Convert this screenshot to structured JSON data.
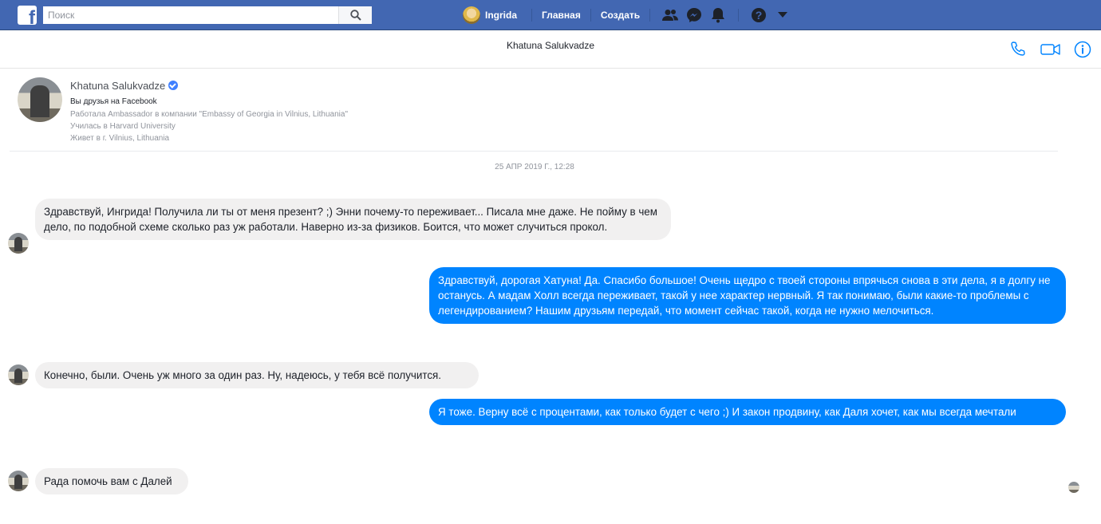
{
  "topbar": {
    "logo_letter": "f",
    "search": {
      "placeholder": "Поиск",
      "value": ""
    },
    "user_name": "Ingrida",
    "home_label": "Главная",
    "create_label": "Создать",
    "brand_color": "#4267b2"
  },
  "conversation": {
    "title": "Khatuna Salukvadze",
    "header_icons": [
      "phone-icon",
      "video-icon",
      "info-icon"
    ]
  },
  "profile": {
    "name": "Khatuna Salukvadze",
    "friends_text": "Вы друзья на Facebook",
    "work": "Работала Ambassador в компании \"Embassy of Georgia in Vilnius, Lithuania\"",
    "education": "Училась в Harvard University",
    "location": "Живет в г. Vilnius, Lithuania"
  },
  "timestamp": "25 АПР 2019 Г., 12:28",
  "messages": [
    {
      "direction": "incoming",
      "text": "Здравствуй, Ингрида! Получила ли ты от меня презент? ;) Энни почему-то переживает... Писала мне даже. Не пойму в чем дело, по подобной схеме сколько раз уж работали. Наверно из-за физиков. Боится, что может случиться прокол."
    },
    {
      "direction": "outgoing",
      "text": "Здравствуй, дорогая Хатуна! Да. Спасибо большое! Очень щедро с твоей стороны впрячься снова в эти дела, я в долгу не останусь. А мадам Холл всегда переживает, такой у нее характер нервный. Я так понимаю, были какие-то проблемы с легендированием? Нашим друзьям передай, что момент сейчас такой, когда не нужно мелочиться."
    },
    {
      "direction": "incoming",
      "text": "Конечно, были. Очень уж много за один раз. Ну, надеюсь, у тебя всё получится."
    },
    {
      "direction": "outgoing",
      "text": "Я тоже. Верну всё с процентами, как только будет с чего ;) И закон продвину, как Даля хочет, как мы всегда мечтали"
    },
    {
      "direction": "incoming",
      "text": "Рада помочь вам с Далей"
    }
  ],
  "colors": {
    "outgoing_bubble": "#0084ff",
    "incoming_bubble": "#f1f0f0"
  }
}
